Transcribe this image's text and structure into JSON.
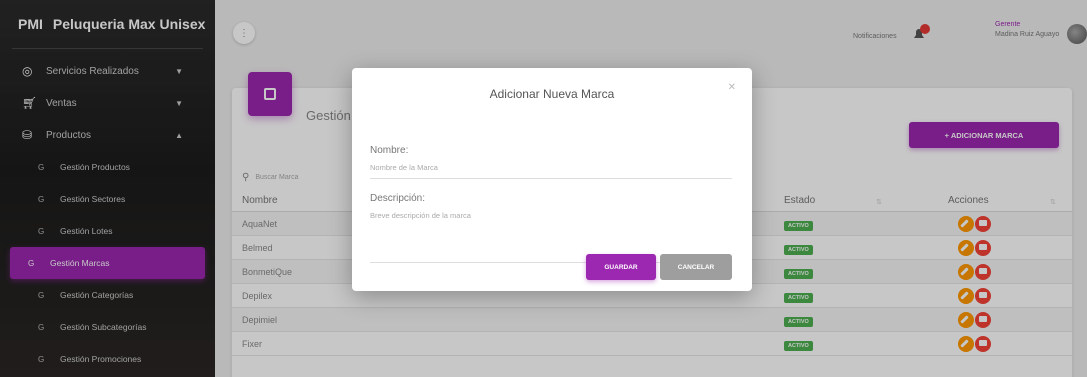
{
  "sidebar": {
    "abbr": "PMI",
    "brand": "Peluqueria Max Unisex",
    "items": [
      {
        "label": "Servicios Realizados",
        "icon": "services-icon"
      },
      {
        "label": "Ventas",
        "icon": "cart-icon"
      },
      {
        "label": "Productos",
        "icon": "products-icon"
      }
    ],
    "subitems": [
      {
        "abbr": "G",
        "label": "Gestión Productos"
      },
      {
        "abbr": "G",
        "label": "Gestión Sectores"
      },
      {
        "abbr": "G",
        "label": "Gestión Lotes"
      },
      {
        "abbr": "G",
        "label": "Gestión Marcas"
      },
      {
        "abbr": "G",
        "label": "Gestión Categorías"
      },
      {
        "abbr": "G",
        "label": "Gestión Subcategorías"
      },
      {
        "abbr": "G",
        "label": "Gestión Promociones"
      }
    ]
  },
  "topbar": {
    "notifications_label": "Notificaciones",
    "user_role": "Gerente",
    "user_name": "Madina Ruiz Aguayo"
  },
  "card": {
    "title": "Gestión de Marcas",
    "add_button": "+ ADICIONAR MARCA",
    "search_placeholder": "Buscar Marca",
    "columns": {
      "name": "Nombre",
      "state": "Estado",
      "actions": "Acciones"
    },
    "rows": [
      {
        "name": "AquaNet",
        "state": "ACTIVO"
      },
      {
        "name": "Belmed",
        "state": "ACTIVO"
      },
      {
        "name": "BonmetiQue",
        "state": "ACTIVO"
      },
      {
        "name": "Depilex",
        "state": "ACTIVO"
      },
      {
        "name": "Depimiel",
        "state": "ACTIVO"
      },
      {
        "name": "Fixer",
        "state": "ACTIVO"
      }
    ]
  },
  "modal": {
    "title": "Adicionar Nueva Marca",
    "name_label": "Nombre:",
    "name_placeholder": "Nombre de la Marca",
    "desc_label": "Descripción:",
    "desc_placeholder": "Breve descripción de la marca",
    "save": "GUARDAR",
    "cancel": "CANCELAR"
  },
  "colors": {
    "accent": "#9c27b0",
    "active_badge": "#4caf50",
    "edit": "#ff9800",
    "delete": "#f44336"
  }
}
